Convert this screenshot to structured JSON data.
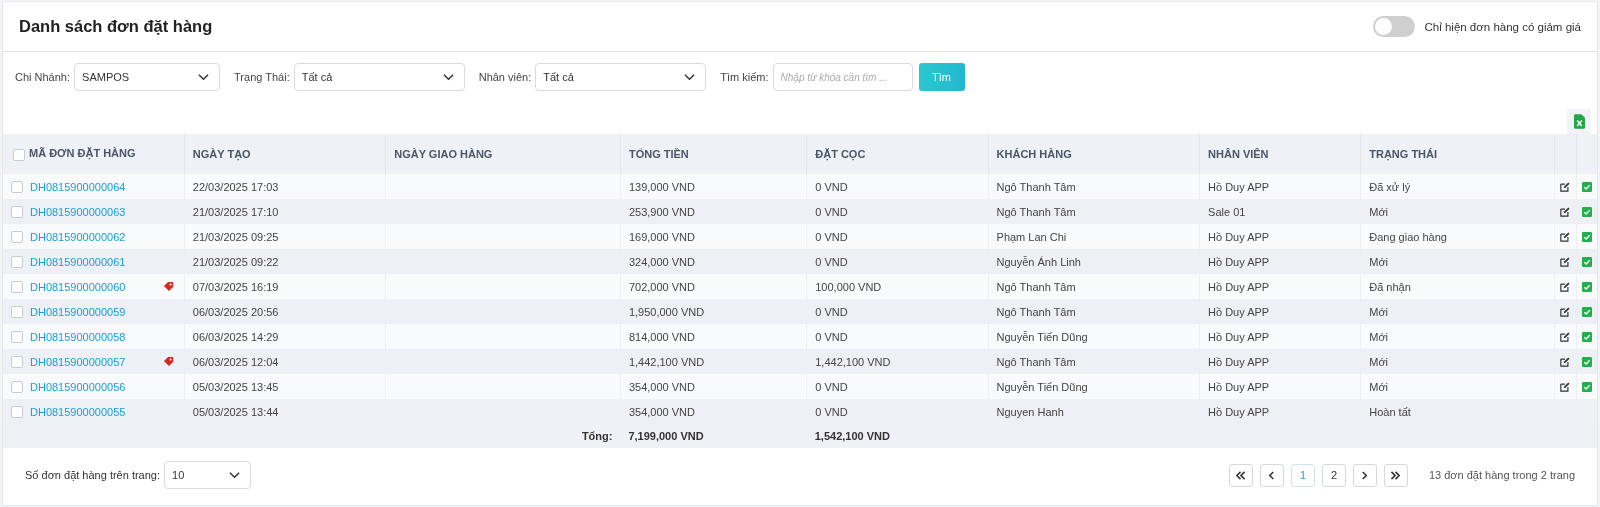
{
  "header": {
    "title": "Danh sách đơn đặt hàng",
    "discount_toggle": {
      "label": "Chỉ hiện đơn hàng có giảm giá",
      "on": false
    }
  },
  "filters": [
    {
      "label": "Chi Nhánh:",
      "value": "SAMPOS"
    },
    {
      "label": "Trạng Thái:",
      "value": "Tất cả"
    },
    {
      "label": "Nhân viên:",
      "value": "Tất cả"
    }
  ],
  "search": {
    "label": "Tìm kiếm:",
    "placeholder": "Nhập từ khóa cần tìm ...",
    "button": "Tìm"
  },
  "table": {
    "select_all": {
      "checked": false
    },
    "columns": [
      "MÃ ĐƠN ĐẶT HÀNG",
      "NGÀY TẠO",
      "NGÀY GIAO HÀNG",
      "TỔNG TIỀN",
      "ĐẶT CỌC",
      "KHÁCH HÀNG",
      "NHÂN VIÊN",
      "TRẠNG THÁI"
    ],
    "rows": [
      {
        "checked": false,
        "code": "DH0815900000064",
        "discount": false,
        "created": "22/03/2025 17:03",
        "total": "139,000 VND",
        "deposit": "0 VND",
        "customer": "Ngô Thanh Tâm",
        "staff": "Hồ Duy APP",
        "status": "Đã xử lý",
        "actions": true
      },
      {
        "checked": false,
        "code": "DH0815900000063",
        "discount": false,
        "created": "21/03/2025 17:10",
        "total": "253,900 VND",
        "deposit": "0 VND",
        "customer": "Ngô Thanh Tâm",
        "staff": "Sale 01",
        "status": "Mới",
        "actions": true
      },
      {
        "checked": false,
        "code": "DH0815900000062",
        "discount": false,
        "created": "21/03/2025 09:25",
        "total": "169,000 VND",
        "deposit": "0 VND",
        "customer": "Phạm Lan Chi",
        "staff": "Hồ Duy APP",
        "status": "Đang giao hàng",
        "actions": true
      },
      {
        "checked": false,
        "code": "DH0815900000061",
        "discount": false,
        "created": "21/03/2025 09:22",
        "total": "324,000 VND",
        "deposit": "0 VND",
        "customer": "Nguyễn Ánh Linh",
        "staff": "Hồ Duy APP",
        "status": "Mới",
        "actions": true
      },
      {
        "checked": false,
        "code": "DH0815900000060",
        "discount": true,
        "created": "07/03/2025 16:19",
        "total": "702,000 VND",
        "deposit": "100,000 VND",
        "customer": "Ngô Thanh Tâm",
        "staff": "Hồ Duy APP",
        "status": "Đã nhận",
        "actions": true
      },
      {
        "checked": false,
        "code": "DH0815900000059",
        "discount": false,
        "created": "06/03/2025 20:56",
        "total": "1,950,000 VND",
        "deposit": "0 VND",
        "customer": "Ngô Thanh Tâm",
        "staff": "Hồ Duy APP",
        "status": "Mới",
        "actions": true
      },
      {
        "checked": false,
        "code": "DH0815900000058",
        "discount": false,
        "created": "06/03/2025 14:29",
        "total": "814,000 VND",
        "deposit": "0 VND",
        "customer": "Nguyễn Tiến Dũng",
        "staff": "Hồ Duy APP",
        "status": "Mới",
        "actions": true
      },
      {
        "checked": false,
        "code": "DH0815900000057",
        "discount": true,
        "created": "06/03/2025 12:04",
        "total": "1,442,100 VND",
        "deposit": "1,442,100 VND",
        "customer": "Ngô Thanh Tâm",
        "staff": "Hồ Duy APP",
        "status": "Mới",
        "actions": true
      },
      {
        "checked": false,
        "code": "DH0815900000056",
        "discount": false,
        "created": "05/03/2025 13:45",
        "total": "354,000 VND",
        "deposit": "0 VND",
        "customer": "Nguyễn Tiến Dũng",
        "staff": "Hồ Duy APP",
        "status": "Mới",
        "actions": true
      },
      {
        "checked": false,
        "code": "DH0815900000055",
        "discount": false,
        "created": "05/03/2025 13:44",
        "total": "354,000 VND",
        "deposit": "0 VND",
        "customer": "Nguyen Hanh",
        "staff": "Hồ Duy APP",
        "status": "Hoàn tất",
        "actions": false
      }
    ],
    "totals": {
      "label": "Tổng:",
      "total": "7,199,000 VND",
      "deposit": "1,542,100 VND"
    }
  },
  "footer": {
    "page_size_label": "Số đơn đặt hàng trên trang:",
    "page_size": "10",
    "pages": [
      {
        "label": "1",
        "selected": true
      },
      {
        "label": "2",
        "selected": false
      }
    ],
    "summary": "13 đơn đặt hàng trong 2 trang"
  }
}
